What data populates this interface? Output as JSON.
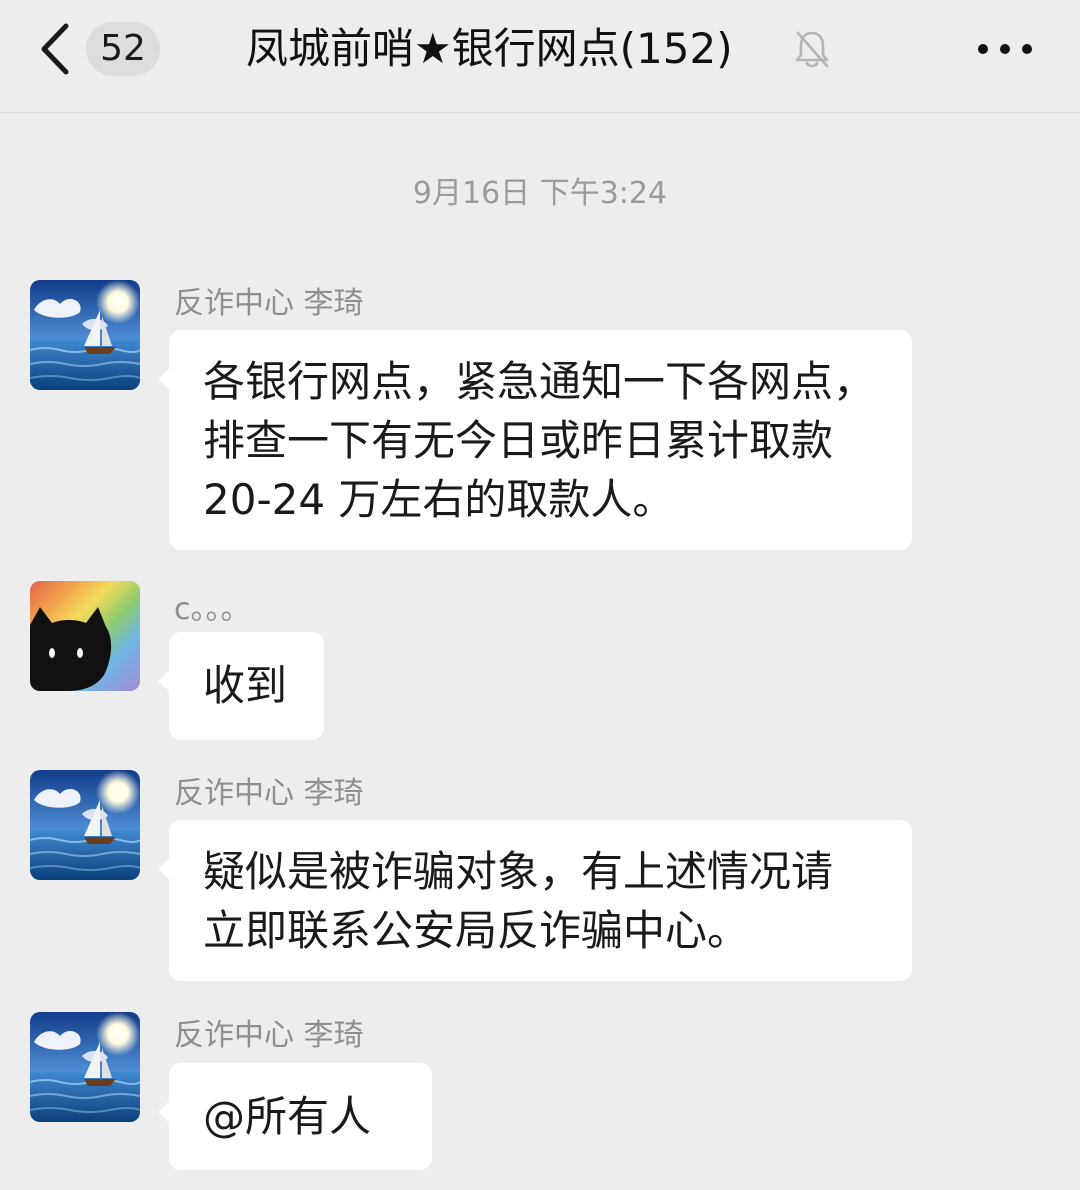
{
  "header": {
    "unread_count": "52",
    "title": "凤城前哨★银行网点(152)",
    "back_icon": "chevron-left-icon",
    "mute_icon": "bell-off-icon",
    "more_icon": "more-dots-icon"
  },
  "timestamp": "9月16日 下午3:24",
  "messages": [
    {
      "sender": "反诈中心 李琦",
      "avatar": "sailboat-sea-avatar",
      "lines": [
        "各银行网点，紧急通知一下各网点，",
        "排查一下有无今日或昨日累计取款",
        "20-24 万左右的取款人。"
      ]
    },
    {
      "sender": "c。。。",
      "avatar": "rainbow-black-cat-avatar",
      "lines": [
        "收到"
      ]
    },
    {
      "sender": "反诈中心 李琦",
      "avatar": "sailboat-sea-avatar",
      "lines": [
        "疑似是被诈骗对象，有上述情况请",
        "立即联系公安局反诈骗中心。"
      ]
    },
    {
      "sender": "反诈中心 李琦",
      "avatar": "sailboat-sea-avatar",
      "lines": [
        "@所有人"
      ]
    }
  ],
  "colors": {
    "background": "#ededed",
    "bubble": "#ffffff",
    "meta_text": "#9b9b9b"
  }
}
